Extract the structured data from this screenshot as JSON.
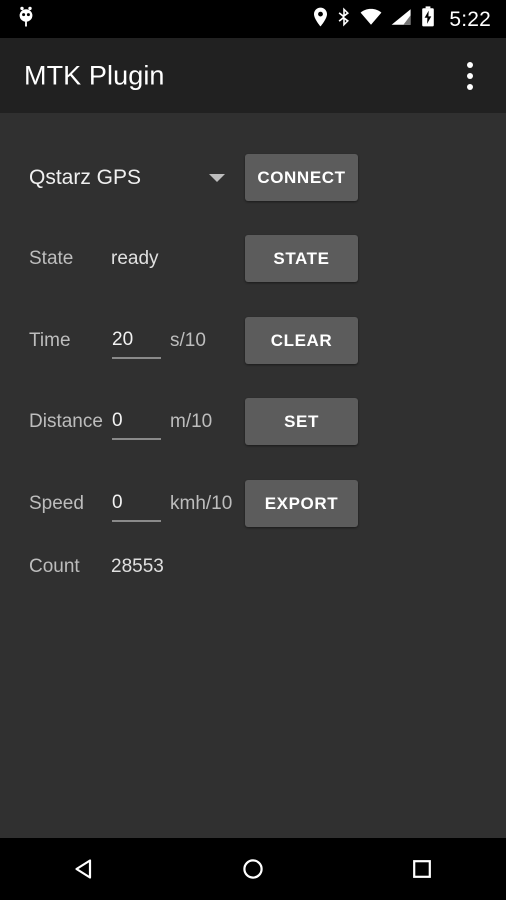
{
  "status_bar": {
    "notification_icon": "android-robot-icon",
    "icons": [
      "location-pin-icon",
      "bluetooth-icon",
      "wifi-icon",
      "cellular-signal-icon",
      "battery-charging-icon"
    ],
    "clock": "5:22",
    "background_color": "#000000"
  },
  "app_bar": {
    "title": "MTK Plugin",
    "overflow_icon": "overflow-menu-icon",
    "background_color": "#212121"
  },
  "theme": {
    "background_color": "#303030",
    "button_color": "#5c5c5c",
    "label_color": "#bdbdbd",
    "value_color": "#e0e0e0",
    "underline_color": "#8a8a8a"
  },
  "device_selector": {
    "selected": "Qstarz GPS",
    "arrow_icon": "chevron-down-icon",
    "options": [
      "Qstarz GPS"
    ]
  },
  "rows": [
    {
      "label": "State",
      "value": "ready",
      "unit": "",
      "editable": false
    },
    {
      "label": "Time",
      "value": "20",
      "unit": "s/10",
      "editable": true
    },
    {
      "label": "Distance",
      "value": "0",
      "unit": "m/10",
      "editable": true
    },
    {
      "label": "Speed",
      "value": "0",
      "unit": "kmh/10",
      "editable": true
    },
    {
      "label": "Count",
      "value": "28553",
      "unit": "",
      "editable": false
    }
  ],
  "buttons": [
    {
      "label": "CONNECT"
    },
    {
      "label": "STATE"
    },
    {
      "label": "CLEAR"
    },
    {
      "label": "SET"
    },
    {
      "label": "EXPORT"
    }
  ],
  "nav_bar": {
    "back": "back-triangle-icon",
    "home": "home-circle-icon",
    "recents": "recents-square-icon",
    "background_color": "#000000"
  }
}
